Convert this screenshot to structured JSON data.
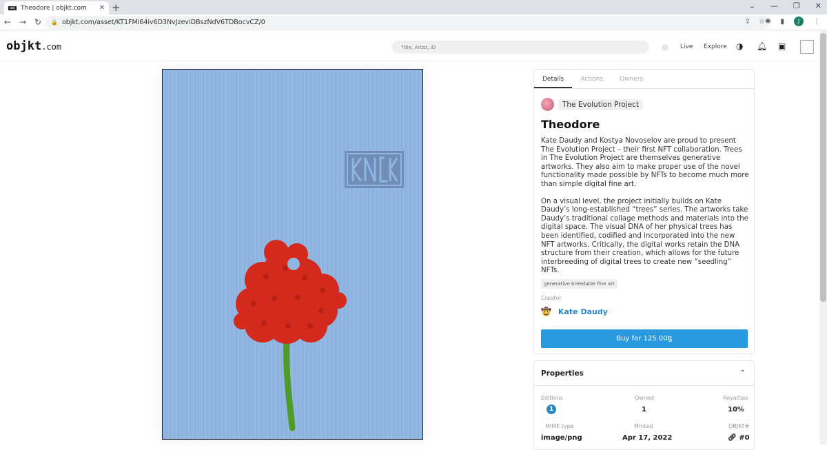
{
  "browser": {
    "tab_title": "Theodore | objkt.com",
    "url": "objkt.com/asset/KT1FMi64iv6D3NvJzeviDBszNdV6TDBocvCZ/0",
    "profile_initial": "J"
  },
  "header": {
    "logo_main": "objkt",
    "logo_suffix": ".com",
    "search_placeholder": "Title, Artist, ID",
    "nav_live": "Live",
    "nav_explore": "Explore"
  },
  "panel": {
    "tabs": [
      "Details",
      "Actions",
      "Owners"
    ],
    "project_name": "The Evolution Project",
    "title": "Theodore",
    "description": [
      "Kate Daudy and Kostya Novoselov are proud to present The Evolution Project – their first NFT collaboration. Trees in The Evolution Project are themselves generative artworks. They also aim to make proper use of the novel functionality made possible by NFTs to become much more than simple digital fine art.",
      "On a visual level, the project initially builds on Kate Daudy’s long-established “trees” series. The artworks take Daudy’s traditional collage methods and materials into the digital space. The visual DNA of her physical trees has been identified, codified and incorporated into the new NFT artworks. Critically, the digital works retain the DNA structure from their creation, which allows for the future interbreeding of digital trees to create new “seedling” NFTs."
    ],
    "tag": "generative breedable fine art",
    "creator_label": "Creator",
    "creator_name": "Kate Daudy",
    "buy_label": "Buy for 125.00ꜩ"
  },
  "properties": {
    "title": "Properties",
    "editions_label": "Editions",
    "editions_value": "1",
    "owned_label": "Owned",
    "owned_value": "1",
    "royalties_label": "Royalties",
    "royalties_value": "10%",
    "mime_label": "MIME type",
    "mime_value": "image/png",
    "minted_label": "Minted",
    "minted_value": "Apr 17, 2022",
    "objkt_label": "OBJKT#",
    "objkt_value": "#0"
  },
  "artwork": {
    "stamp_text": "KNCK",
    "background_color": "#8fb5e0",
    "flower_color": "#d42a1e",
    "stem_color": "#4e9a2a"
  }
}
